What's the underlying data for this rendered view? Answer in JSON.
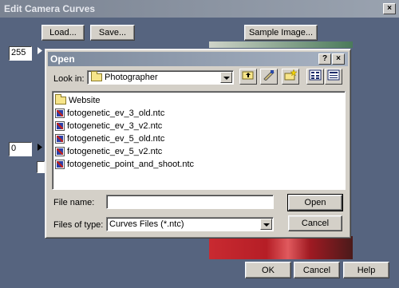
{
  "outer": {
    "title": "Edit Camera Curves",
    "close": "×",
    "load_label": "Load...",
    "save_label": "Save...",
    "sample_label": "Sample Image...",
    "value_top": "255",
    "value_bottom": "0",
    "ok_label": "OK",
    "cancel_label": "Cancel",
    "help_label": "Help"
  },
  "dialog": {
    "title": "Open",
    "help_btn": "?",
    "close_btn": "×",
    "look_in_label": "Look in:",
    "look_in_value": "Photographer",
    "files": [
      {
        "name": "Website",
        "type": "folder"
      },
      {
        "name": "fotogenetic_ev_3_old.ntc",
        "type": "ntc"
      },
      {
        "name": "fotogenetic_ev_3_v2.ntc",
        "type": "ntc"
      },
      {
        "name": "fotogenetic_ev_5_old.ntc",
        "type": "ntc"
      },
      {
        "name": "fotogenetic_ev_5_v2.ntc",
        "type": "ntc"
      },
      {
        "name": "fotogenetic_point_and_shoot.ntc",
        "type": "ntc"
      }
    ],
    "file_name_label": "File name:",
    "file_name_value": "",
    "files_of_type_label": "Files of type:",
    "files_of_type_value": "Curves Files (*.ntc)",
    "open_label": "Open",
    "cancel_label": "Cancel"
  }
}
